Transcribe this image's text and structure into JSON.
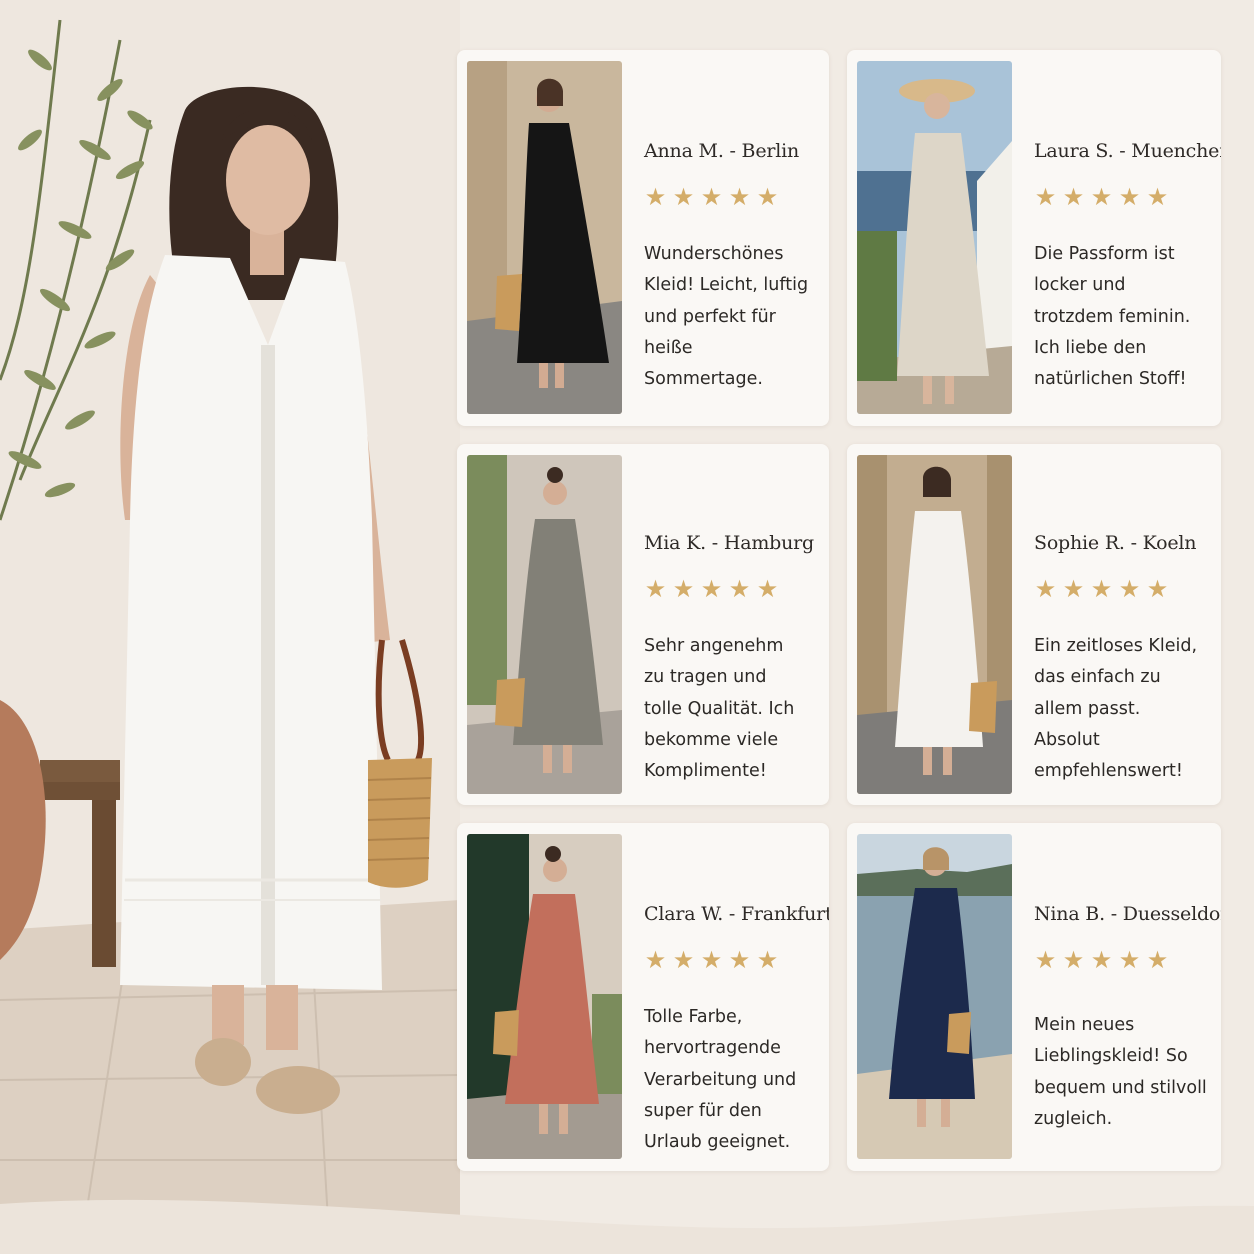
{
  "colors": {
    "background": "#f1ebe4",
    "card": "#faf8f5",
    "star": "#d4ad69",
    "text": "#2c2926"
  },
  "hero": {
    "icon": "hero-model-white-linen-dress"
  },
  "reviews": [
    {
      "name": "Anna M. - Berlin",
      "rating": 5,
      "stars": "★★★★★",
      "text": "Wunderschönes Kleid! Leicht, luftig und perfekt für heiße Sommertage.",
      "dress_color": "#151515",
      "photo_icon": "black-dress-photo"
    },
    {
      "name": "Laura S. - Muenchen",
      "rating": 5,
      "stars": "★★★★★",
      "text": "Die Passform ist locker und trotzdem feminin. Ich liebe den natürlichen Stoff!",
      "dress_color": "#ddd6c8",
      "photo_icon": "beige-dress-photo"
    },
    {
      "name": "Mia K. - Hamburg",
      "rating": 5,
      "stars": "★★★★★",
      "text": "Sehr angenehm zu tragen und tolle Qualität. Ich bekomme viele Komplimente!",
      "dress_color": "#828077",
      "photo_icon": "grey-dress-photo"
    },
    {
      "name": "Sophie R. - Koeln",
      "rating": 5,
      "stars": "★★★★★",
      "text": "Ein zeitloses Kleid, das einfach zu allem passt. Absolut empfehlenswert!",
      "dress_color": "#f4f2ee",
      "photo_icon": "white-dress-photo"
    },
    {
      "name": "Clara W. - Frankfurt",
      "rating": 5,
      "stars": "★★★★★",
      "text": "Tolle Farbe, hervortragende Verarbeitung und super für den Urlaub geeignet.",
      "dress_color": "#c26f5c",
      "photo_icon": "terracotta-dress-photo"
    },
    {
      "name": "Nina B. - Duesseldorf",
      "rating": 5,
      "stars": "★★★★★",
      "text": "Mein neues Lieblingskleid! So bequem und stilvoll zugleich.",
      "dress_color": "#1c2a4c",
      "photo_icon": "navy-dress-photo"
    }
  ]
}
